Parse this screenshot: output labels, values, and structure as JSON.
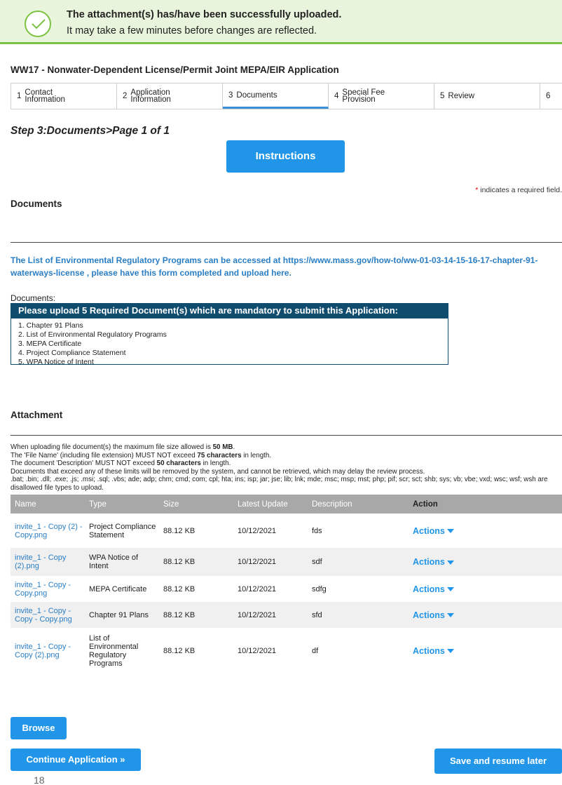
{
  "banner": {
    "title": "The attachment(s) has/have been successfully uploaded.",
    "subtitle": "It may take a few minutes before changes are reflected.",
    "icon": "check-circle-icon"
  },
  "app_title": "WW17 - Nonwater-Dependent License/Permit Joint MEPA/EIR Application",
  "steps": [
    {
      "num": "1",
      "label": "Contact Information"
    },
    {
      "num": "2",
      "label": "Application Information"
    },
    {
      "num": "3",
      "label": "Documents"
    },
    {
      "num": "4",
      "label": "Special Fee Provision"
    },
    {
      "num": "5",
      "label": "Review"
    },
    {
      "num": "6",
      "label": ""
    }
  ],
  "active_step": 3,
  "step_heading": "Step 3:Documents>Page 1 of 1",
  "instructions_label": "Instructions",
  "required_note": {
    "star": "*",
    "text": " indicates a required field."
  },
  "documents_section": {
    "title": "Documents",
    "info_text": "The List of Environmental Regulatory Programs can be accessed at https://www.mass.gov/how-to/ww-01-03-14-15-16-17-chapter-91-waterways-license , please have this form completed and upload here.",
    "label": "Documents:",
    "required_header": "Please upload 5 Required Document(s) which are mandatory to submit this Application:",
    "required_items": [
      "1. Chapter 91 Plans",
      "2. List of Environmental Regulatory Programs",
      "3. MEPA Certificate",
      "4. Project Compliance Statement",
      "5. WPA Notice of Intent"
    ]
  },
  "attachment_section": {
    "title": "Attachment",
    "limits": {
      "line1_pre": "When uploading file document(s) the maximum file size allowed is ",
      "line1_bold": "50 MB",
      "line1_post": ".",
      "line2_pre": "The 'File Name' (including file extension) MUST NOT exceed ",
      "line2_bold": "75 characters",
      "line2_post": " in length.",
      "line3_pre": "The document 'Description' MUST NOT exceed ",
      "line3_bold": "50 characters",
      "line3_post": " in length.",
      "line4": "Documents that exceed any of these limits will be removed by the system, and cannot be retrieved, which may delay the review process.",
      "line5": ".bat; .bin; .dll; .exe; .js; .msi; .sql; .vbs; ade; adp; chm; cmd; com; cpl; hta; ins; isp; jar; jse; lib; lnk; mde; msc; msp; mst; php; pif; scr; sct; shb; sys; vb; vbe; vxd; wsc; wsf; wsh are disallowed file types to upload."
    },
    "columns": [
      "Name",
      "Type",
      "Size",
      "Latest Update",
      "Description",
      "Action"
    ],
    "rows": [
      {
        "name": "invite_1 - Copy (2) - Copy.png",
        "type": "Project Compliance Statement",
        "size": "88.12 KB",
        "updated": "10/12/2021",
        "description": "fds",
        "action": "Actions"
      },
      {
        "name": "invite_1 - Copy (2).png",
        "type": "WPA Notice of Intent",
        "size": "88.12 KB",
        "updated": "10/12/2021",
        "description": "sdf",
        "action": "Actions"
      },
      {
        "name": "invite_1 - Copy - Copy.png",
        "type": "MEPA Certificate",
        "size": "88.12 KB",
        "updated": "10/12/2021",
        "description": "sdfg",
        "action": "Actions"
      },
      {
        "name": "invite_1 - Copy - Copy - Copy.png",
        "type": "Chapter 91 Plans",
        "size": "88.12 KB",
        "updated": "10/12/2021",
        "description": "sfd",
        "action": "Actions"
      },
      {
        "name": "invite_1 - Copy - Copy (2).png",
        "type": "List of Environmental Regulatory Programs",
        "size": "88.12 KB",
        "updated": "10/12/2021",
        "description": "df",
        "action": "Actions"
      }
    ]
  },
  "buttons": {
    "browse": "Browse",
    "continue": "Continue Application »",
    "save": "Save and resume later"
  },
  "page_number": "18"
}
